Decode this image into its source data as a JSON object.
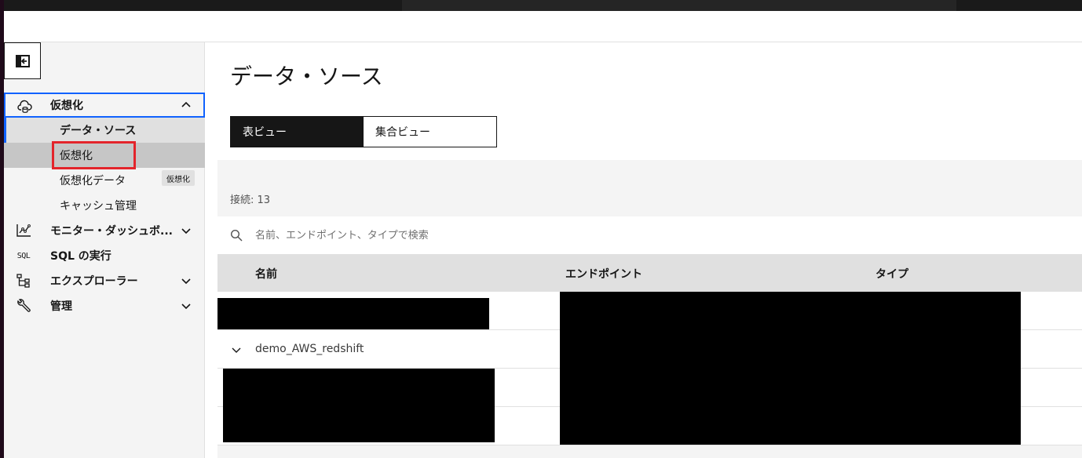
{
  "sidebar": {
    "collapse_icon": "panel-collapse-icon",
    "groups": [
      {
        "label": "仮想化",
        "icon": "cloud-data-icon",
        "expanded": true
      },
      {
        "label": "モニター・ダッシュボ...",
        "icon": "chart-line-icon",
        "expanded": false
      },
      {
        "label": "SQL の実行",
        "icon": "sql-icon",
        "icon_text": "SQL"
      },
      {
        "label": "エクスプローラー",
        "icon": "tree-view-icon",
        "expanded": false
      },
      {
        "label": "管理",
        "icon": "wrench-icon",
        "expanded": false
      }
    ],
    "subitems": [
      {
        "label": "データ・ソース",
        "selected": true
      },
      {
        "label": "仮想化",
        "hovered": true
      },
      {
        "label": "仮想化データ"
      },
      {
        "label": "キャッシュ管理"
      }
    ],
    "tooltip": "仮想化"
  },
  "main": {
    "title": "データ・ソース",
    "view_switch": {
      "table_view": "表ビュー",
      "aggregate_view": "集合ビュー",
      "active": "表ビュー"
    },
    "connections_label": "接続: 13",
    "search_placeholder": "名前、エンドポイント、タイプで検索",
    "columns": {
      "name": "名前",
      "endpoint": "エンドポイント",
      "type": "タイプ"
    },
    "rows": [
      {
        "name": ""
      },
      {
        "name": "demo_AWS_redshift"
      },
      {
        "name": ""
      },
      {
        "name": ""
      }
    ]
  },
  "colors": {
    "accent": "#0f62fe",
    "highlight": "#e3242b",
    "dark": "#161616"
  }
}
